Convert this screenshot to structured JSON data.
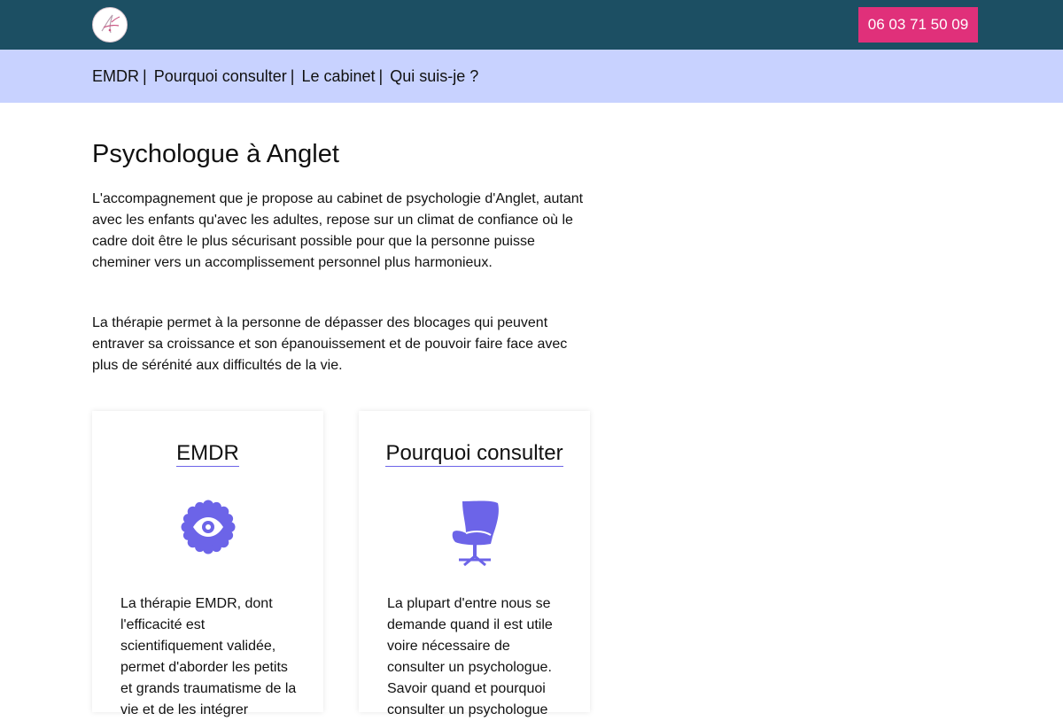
{
  "colors": {
    "header_bg": "#1c4f63",
    "nav_bg": "#c8d2ff",
    "accent": "#e0307a",
    "icon": "#6c64e8"
  },
  "header": {
    "logo_icon": "signature-logo",
    "phone_label": "06 03 71 50 09"
  },
  "nav": {
    "items": [
      {
        "label": "EMDR",
        "sep": "|"
      },
      {
        "label": "Pourquoi consulter",
        "sep": "|"
      },
      {
        "label": "Le cabinet",
        "sep": "|"
      },
      {
        "label": "Qui suis-je ?",
        "sep": ""
      }
    ]
  },
  "main": {
    "title": "Psychologue à Anglet",
    "paragraphs": [
      "L'accompagnement que je propose au cabinet de psychologie d'Anglet, autant avec les enfants qu'avec les adultes, repose sur un climat de confiance où le cadre doit être le plus sécurisant possible pour que la personne puisse cheminer vers un accomplissement personnel plus harmonieux.",
      "La thérapie permet à la personne de dépasser des blocages qui peuvent entraver sa croissance et son épanouissement et de pouvoir faire face avec plus de sérénité aux difficultés de la vie."
    ],
    "cards": [
      {
        "title": "EMDR",
        "icon": "eye-badge-icon",
        "text": "La thérapie EMDR, dont l'efficacité est scientifiquement validée, permet d'aborder les petits et grands traumatisme de la vie et de les intégrer"
      },
      {
        "title": "Pourquoi consulter",
        "icon": "armchair-icon",
        "text": "La plupart d'entre nous se demande quand il est utile voire nécessaire de consulter un psychologue. Savoir quand et pourquoi consulter un psychologue"
      }
    ]
  }
}
